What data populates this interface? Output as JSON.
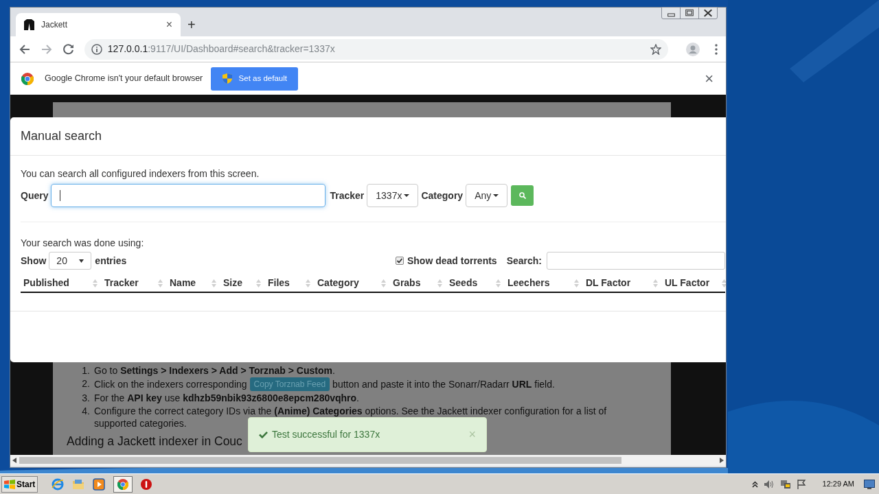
{
  "browser": {
    "tab": {
      "title": "Jackett",
      "close": "×"
    },
    "new_tab": "+",
    "address": {
      "host": "127.0.0.1",
      "rest": ":9117/UI/Dashboard#search&tracker=1337x"
    },
    "infobar": {
      "message": "Google Chrome isn't your default browser",
      "button": "Set as default",
      "close": "×"
    }
  },
  "background_page": {
    "steps": [
      {
        "number": "1.",
        "text": "Go to **Settings > Indexers > Add > Torznab > Custom**."
      },
      {
        "number": "2.",
        "before": "Click on the indexers corresponding",
        "button": "Copy Torznab Feed",
        "after": "button and paste it into the Sonarr/Radarr **URL** field."
      },
      {
        "number": "3.",
        "text": "For the **API key** use **kdhzb59nbik93z6800e8epcm280vqhro**."
      },
      {
        "number": "4.",
        "text": "Configure the correct category IDs via the **(Anime) Categories** options. See the Jackett indexer configuration for a list of supported categories."
      }
    ],
    "heading": "Adding a Jackett indexer in Couc"
  },
  "modal": {
    "title": "Manual search",
    "intro": "You can search all configured indexers from this screen.",
    "query_label": "Query",
    "tracker": {
      "label": "Tracker",
      "value": "1337x"
    },
    "category": {
      "label": "Category",
      "value": "Any"
    },
    "done_using": "Your search was done using:",
    "show": {
      "before": "Show",
      "value": "20",
      "after": "entries"
    },
    "dead_torrents": {
      "label": "Show dead torrents",
      "checked": true
    },
    "search_label": "Search:",
    "columns": [
      "Published",
      "Tracker",
      "Name",
      "Size",
      "Files",
      "Category",
      "Grabs",
      "Seeds",
      "Leechers",
      "DL Factor",
      "UL Factor"
    ]
  },
  "toast": {
    "message": "Test successful for 1337x",
    "close": "×"
  },
  "taskbar": {
    "start": "Start",
    "clock": "12:29 AM"
  }
}
